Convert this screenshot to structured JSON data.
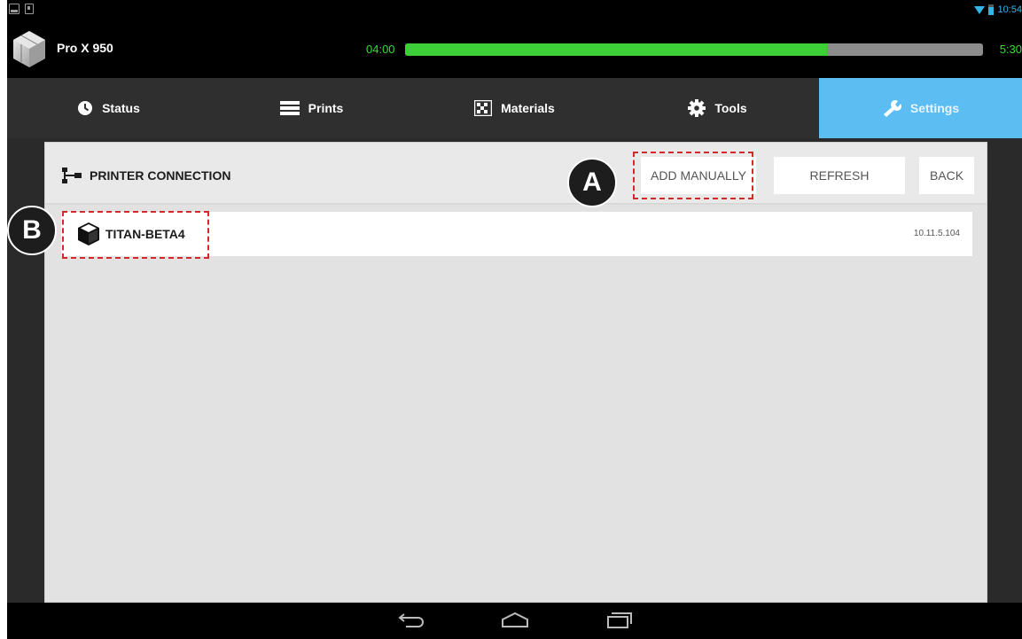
{
  "status_bar": {
    "clock": "10:54"
  },
  "header": {
    "printer_name": "Pro X 950",
    "time_elapsed": "04:00",
    "time_total": "5:30",
    "progress_fraction": 0.73,
    "accent_green": "#3ecf38"
  },
  "tabs": [
    {
      "label": "Status",
      "icon": "clock-icon",
      "active": false
    },
    {
      "label": "Prints",
      "icon": "list-icon",
      "active": false
    },
    {
      "label": "Materials",
      "icon": "checker-icon",
      "active": false
    },
    {
      "label": "Tools",
      "icon": "gear-icon",
      "active": false
    },
    {
      "label": "Settings",
      "icon": "wrench-icon",
      "active": true
    }
  ],
  "active_tab_color": "#5cbdf2",
  "toolbar": {
    "title": "PRINTER CONNECTION",
    "add_manually_label": "ADD MANUALLY",
    "refresh_label": "REFRESH",
    "back_label": "BACK"
  },
  "printers": [
    {
      "name": "TITAN-BETA4",
      "ip": "10.11.5.104"
    }
  ],
  "annotations": {
    "callout_a": "A",
    "callout_b": "B",
    "color": "#d22a2a"
  },
  "nav": {
    "buttons": [
      "back-icon",
      "home-icon",
      "recents-icon"
    ]
  }
}
